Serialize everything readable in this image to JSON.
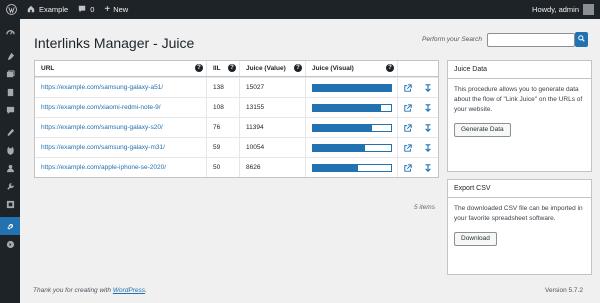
{
  "adminbar": {
    "site_name": "Example",
    "comments_count": "0",
    "new_label": "New",
    "howdy": "Howdy, admin"
  },
  "sidebar": {
    "icons": [
      "dashboard-icon",
      "posts-icon",
      "media-icon",
      "pages-icon",
      "comments-icon",
      "appearance-icon",
      "plugins-icon",
      "users-icon",
      "tools-icon",
      "settings-icon",
      "interlinks-icon",
      "collapse-icon"
    ],
    "active": "interlinks-icon"
  },
  "page": {
    "title": "Interlinks Manager - Juice",
    "search_label": "Perform your Search",
    "search_value": ""
  },
  "table": {
    "columns": [
      "URL",
      "IIL",
      "Juice (Value)",
      "Juice (Visual)"
    ],
    "rows": [
      {
        "url": "https://example.com/samsung-galaxy-a51/",
        "iil": "138",
        "juice": "15027",
        "visual": 1.0
      },
      {
        "url": "https://example.com/xiaomi-redmi-note-9/",
        "iil": "108",
        "juice": "13155",
        "visual": 0.875
      },
      {
        "url": "https://example.com/samsung-galaxy-s20/",
        "iil": "76",
        "juice": "11394",
        "visual": 0.758
      },
      {
        "url": "https://example.com/samsung-galaxy-m31/",
        "iil": "59",
        "juice": "10054",
        "visual": 0.669
      },
      {
        "url": "https://example.com/apple-iphone-se-2020/",
        "iil": "50",
        "juice": "8626",
        "visual": 0.574
      }
    ],
    "items_count": "5 items"
  },
  "juice_data_box": {
    "title": "Juice Data",
    "text": "This procedure allows you to generate data about the flow of \"Link Juice\" on the URLs of your website.",
    "button": "Generate Data"
  },
  "export_box": {
    "title": "Export CSV",
    "text": "The downloaded CSV file can be imported in your favorite spreadsheet software.",
    "button": "Download"
  },
  "footer": {
    "thanks_prefix": "Thank you for creating with",
    "thanks_link": "WordPress",
    "thanks_suffix": ".",
    "version": "Version 5.7.2"
  },
  "colors": {
    "accent": "#2271b1",
    "adminbar": "#1d2327"
  }
}
